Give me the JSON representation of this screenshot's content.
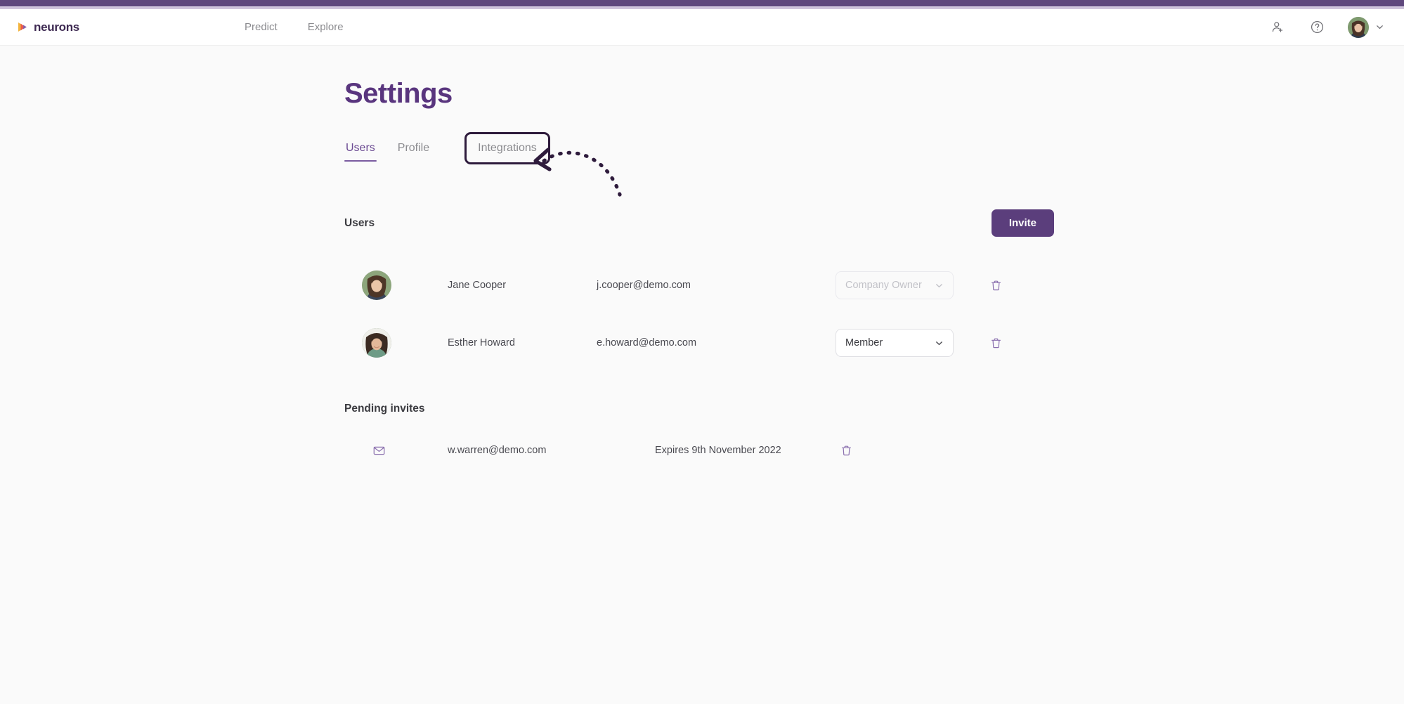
{
  "brand": {
    "logo_text": "neurons",
    "accent_purple": "#5B3E7C",
    "title_purple": "#59357E",
    "strip_purple": "#5F487D",
    "strip_light": "#CFC4DC",
    "icon_purple": "#8A6FAE",
    "annotation_dark": "#2E1B3C"
  },
  "header": {
    "nav": [
      {
        "label": "Predict"
      },
      {
        "label": "Explore"
      }
    ],
    "icons": {
      "add_user": "add-user-icon",
      "help": "help-circle-icon",
      "avatar": "avatar-icon",
      "chevron": "chevron-down-icon"
    }
  },
  "page": {
    "title": "Settings"
  },
  "tabs": [
    {
      "label": "Users",
      "active": true,
      "annotated": false
    },
    {
      "label": "Profile",
      "active": false,
      "annotated": false
    },
    {
      "label": "Integrations",
      "active": false,
      "annotated": true
    }
  ],
  "users_section": {
    "title": "Users",
    "invite_button": "Invite",
    "rows": [
      {
        "name": "Jane Cooper",
        "email": "j.cooper@demo.com",
        "role": "Company Owner",
        "role_disabled": true,
        "delete_icon": "trash-icon"
      },
      {
        "name": "Esther Howard",
        "email": "e.howard@demo.com",
        "role": "Member",
        "role_disabled": false,
        "delete_icon": "trash-icon"
      }
    ]
  },
  "pending_section": {
    "title": "Pending invites",
    "rows": [
      {
        "mail_icon": "mail-icon",
        "email": "w.warren@demo.com",
        "expires": "Expires 9th November 2022",
        "delete_icon": "trash-icon"
      }
    ]
  },
  "annotation": {
    "type": "curved-dashed-arrow",
    "points_to": "Integrations"
  }
}
